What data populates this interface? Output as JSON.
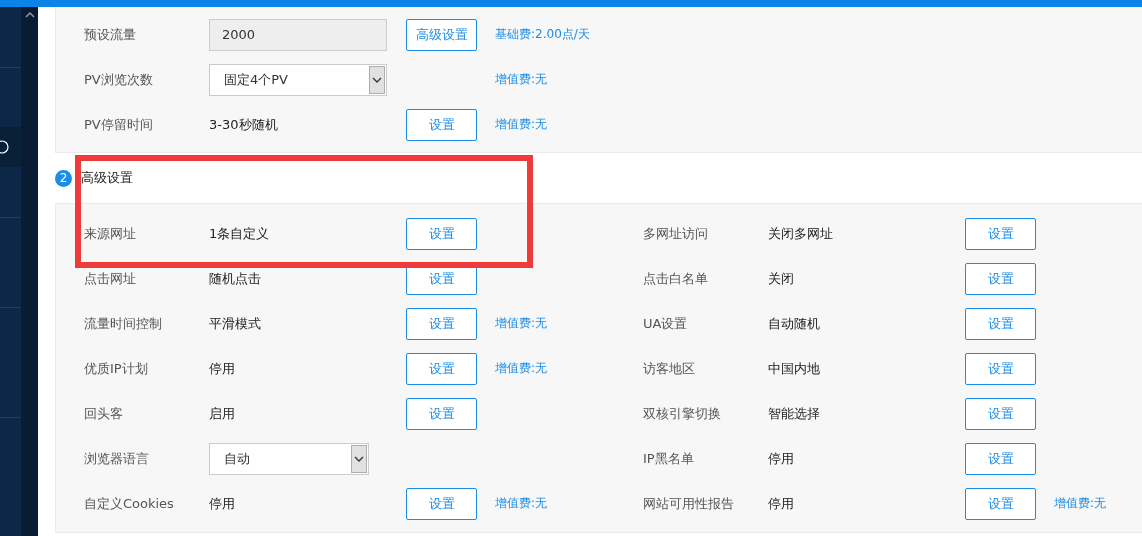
{
  "basic_rows": [
    {
      "label": "预设流量",
      "kind": "input",
      "value": "2000",
      "button": "高级设置",
      "fee": "基础费:2.00点/天"
    },
    {
      "label": "PV浏览次数",
      "kind": "select",
      "value": "固定4个PV",
      "fee": "增值费:无"
    },
    {
      "label": "PV停留时间",
      "kind": "text",
      "value": "3-30秒随机",
      "button": "设置",
      "fee": "增值费:无"
    }
  ],
  "advanced": {
    "number": "2",
    "title": "高级设置",
    "left": [
      {
        "label": "来源网址",
        "kind": "text",
        "value": "1条自定义",
        "button": "设置"
      },
      {
        "label": "点击网址",
        "kind": "text",
        "value": "随机点击",
        "button": "设置"
      },
      {
        "label": "流量时间控制",
        "kind": "text",
        "value": "平滑模式",
        "button": "设置",
        "fee": "增值费:无"
      },
      {
        "label": "优质IP计划",
        "kind": "text",
        "value": "停用",
        "button": "设置",
        "fee": "增值费:无"
      },
      {
        "label": "回头客",
        "kind": "text",
        "value": "启用",
        "button": "设置"
      },
      {
        "label": "浏览器语言",
        "kind": "select",
        "value": "自动"
      },
      {
        "label": "自定义Cookies",
        "kind": "text",
        "value": "停用",
        "button": "设置",
        "fee": "增值费:无"
      }
    ],
    "right": [
      {
        "label": "多网址访问",
        "kind": "text",
        "value": "关闭多网址",
        "button": "设置"
      },
      {
        "label": "点击白名单",
        "kind": "text",
        "value": "关闭",
        "button": "设置"
      },
      {
        "label": "UA设置",
        "kind": "text",
        "value": "自动随机",
        "button": "设置"
      },
      {
        "label": "访客地区",
        "kind": "text",
        "value": "中国内地",
        "button": "设置"
      },
      {
        "label": "双核引擎切换",
        "kind": "text",
        "value": "智能选择",
        "button": "设置"
      },
      {
        "label": "IP黑名单",
        "kind": "text",
        "value": "停用",
        "button": "设置"
      },
      {
        "label": "网站可用性报告",
        "kind": "text",
        "value": "停用",
        "button": "设置",
        "fee": "增值费:无"
      }
    ]
  }
}
